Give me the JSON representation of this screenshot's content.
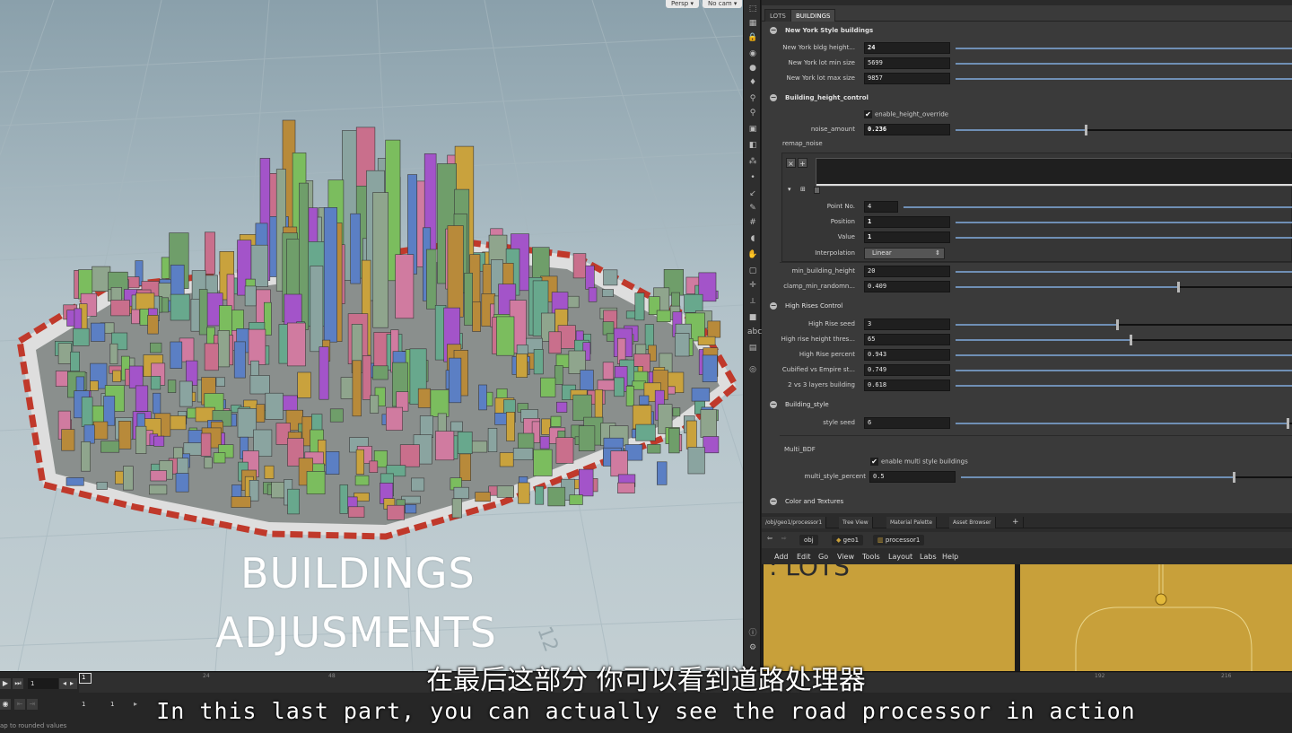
{
  "viewport": {
    "camera_buttons": [
      "Persp ▾",
      "No cam ▾"
    ],
    "overlay_line1": "BUILDINGS",
    "overlay_line2": "ADJUSMENTS",
    "grid_label": "12"
  },
  "param_tabs": [
    "LOTS",
    "BUILDINGS"
  ],
  "params": {
    "ny_folder": "New York Style buildings",
    "ny_height_label": "New York bldg height...",
    "ny_height_value": "24",
    "ny_lot_min_label": "New York lot min size",
    "ny_lot_min_value": "5699",
    "ny_lot_max_label": "New York lot max size",
    "ny_lot_max_value": "9857",
    "height_folder": "Building_height_control",
    "enable_height_override": "enable_height_override",
    "noise_amount_label": "noise_amount",
    "noise_amount_value": "0.236",
    "remap_noise_label": "remap_noise",
    "ramp_buttons": [
      "×",
      "+"
    ],
    "point_no_label": "Point No.",
    "point_no_value": "4",
    "position_label": "Position",
    "position_value": "1",
    "value_label": "Value",
    "value_value": "1",
    "interpolation_label": "Interpolation",
    "interpolation_value": "Linear",
    "min_building_height_label": "min_building_height",
    "min_building_height_value": "20",
    "clamp_label": "clamp_min_randomn...",
    "clamp_value": "0.409",
    "high_rises_folder": "High Rises Control",
    "high_rise_seed_label": "High Rise seed",
    "high_rise_seed_value": "3",
    "high_rise_thres_label": "High rise height thres...",
    "high_rise_thres_value": "65",
    "high_rise_percent_label": "High Rise percent",
    "high_rise_percent_value": "0.943",
    "cubified_label": "Cubified vs Empire st...",
    "cubified_value": "0.749",
    "layers_label": "2 vs 3 layers building",
    "layers_value": "0.618",
    "style_folder": "Building_style",
    "style_seed_label": "style seed",
    "style_seed_value": "6",
    "multi_bdf_label": "Multi_BDF",
    "enable_multi_style": "enable multi style buildings",
    "multi_style_percent_label": "multi_style_percent",
    "multi_style_percent_value": "0.5",
    "color_folder": "Color and Textures"
  },
  "slider_levels": {
    "ny_height": 1.0,
    "ny_lot_min": 1.0,
    "ny_lot_max": 1.0,
    "noise_amount": 0.38,
    "point_no": 1.0,
    "position": 1.0,
    "value": 1.0,
    "min_building_height": 1.0,
    "clamp": 0.65,
    "high_rise_seed": 0.47,
    "high_rise_thres": 0.51,
    "high_rise_percent": 1.0,
    "cubified": 1.0,
    "layers": 1.0,
    "style_seed": 0.97,
    "multi_style_percent": 0.81
  },
  "network": {
    "pane_tabs": [
      "/obj/geo1/processor1",
      "Tree View",
      "Material Palette",
      "Asset Browser",
      "+"
    ],
    "crumbs": [
      "obj",
      "geo1",
      "processor1"
    ],
    "menu": [
      "Add",
      "Edit",
      "Go",
      "View",
      "Tools",
      "Layout",
      "Labs",
      "Help"
    ],
    "box_title": ": LOTS"
  },
  "timeline": {
    "frame_start": "1",
    "frame_current": "1",
    "range_start": "1",
    "range_end": "1",
    "ticks": [
      "1",
      "24",
      "48",
      "192",
      "216"
    ],
    "status": "ap to rounded values"
  },
  "subtitles": {
    "cn": "在最后这部分 你可以看到道路处理器",
    "en": "In this last part, you can actually see the road processor in action"
  },
  "colors": {
    "slider_fill": "#6f8fb5",
    "network_box": "#c8a03a",
    "viewport_sky": "#9fb3bc"
  }
}
